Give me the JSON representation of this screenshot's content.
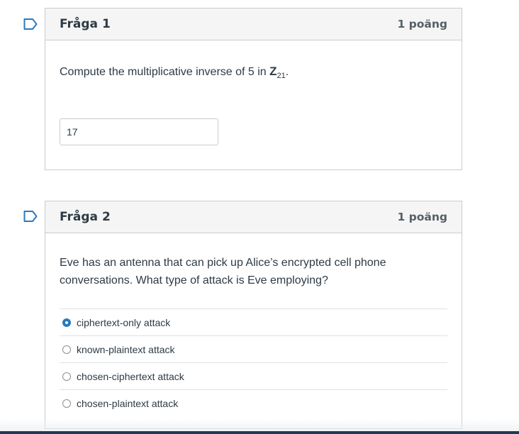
{
  "questions": [
    {
      "title": "Fråga 1",
      "points": "1 poäng",
      "text_before": "Compute the multiplicative inverse of 5 in ",
      "set_symbol": "Z",
      "set_subscript": "21",
      "text_after": ".",
      "answer_value": "17"
    },
    {
      "title": "Fråga 2",
      "points": "1 poäng",
      "text": "Eve has an antenna that can pick up Alice’s encrypted cell phone conversations. What type of attack is Eve employing?",
      "options": [
        {
          "label": "ciphertext-only attack",
          "selected": true
        },
        {
          "label": "known-plaintext attack",
          "selected": false
        },
        {
          "label": "chosen-ciphertext attack",
          "selected": false
        },
        {
          "label": "chosen-plaintext attack",
          "selected": false
        }
      ]
    }
  ],
  "colors": {
    "flag": "#2b7abc",
    "selected_radio": "#2b7abc",
    "border": "#c7cdd1",
    "header_bg": "#f5f5f5",
    "text": "#2d3b45"
  }
}
